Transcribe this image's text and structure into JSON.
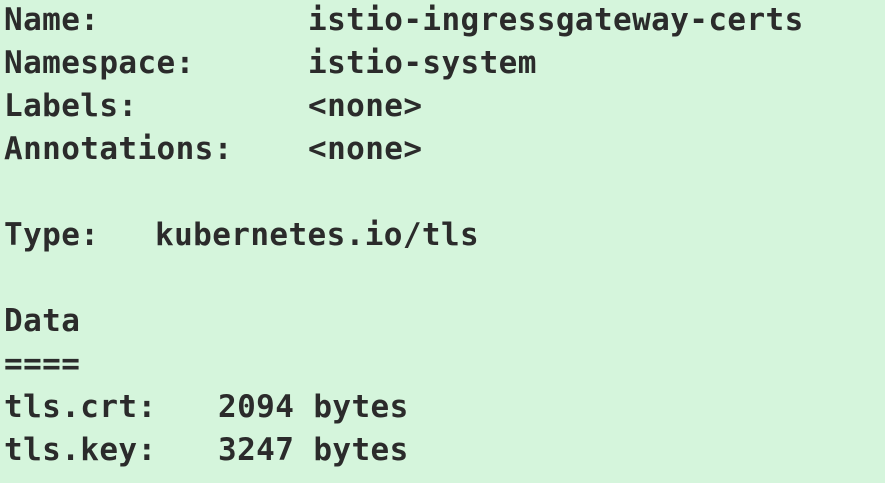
{
  "secret": {
    "name_label": "Name:",
    "name_value": "istio-ingressgateway-certs",
    "namespace_label": "Namespace:",
    "namespace_value": "istio-system",
    "labels_label": "Labels:",
    "labels_value": "<none>",
    "annotations_label": "Annotations:",
    "annotations_value": "<none>",
    "type_label": "Type:",
    "type_value": "kubernetes.io/tls"
  },
  "data_section": {
    "heading": "Data",
    "separator": "====",
    "items": [
      {
        "key": "tls.crt:",
        "value": "2094 bytes"
      },
      {
        "key": "tls.key:",
        "value": "3247 bytes"
      }
    ]
  },
  "colors": {
    "background": "#d5f5dc",
    "text": "#2b2b2b"
  }
}
